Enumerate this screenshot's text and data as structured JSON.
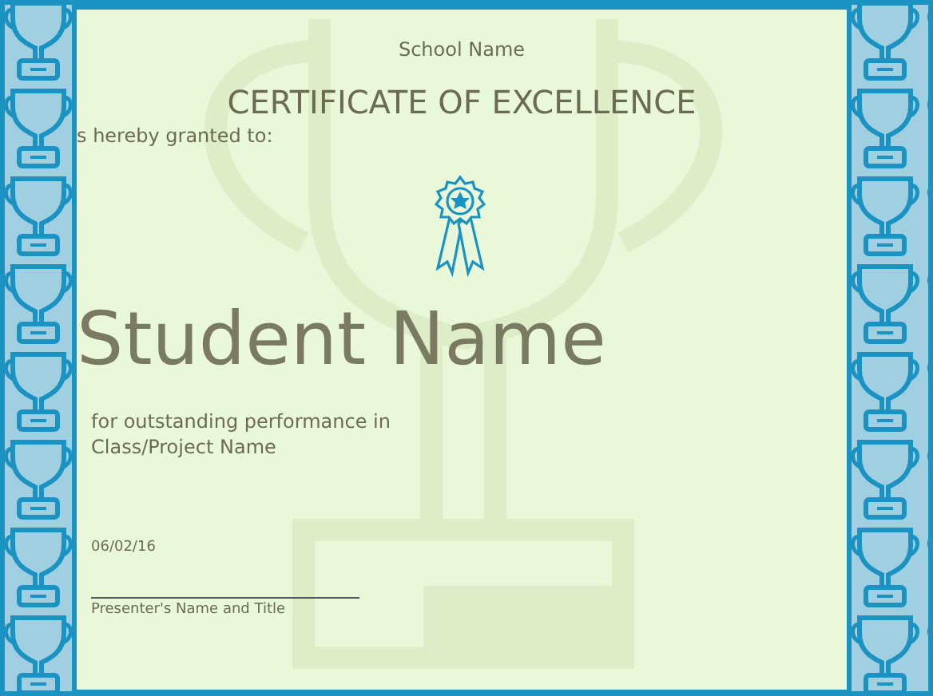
{
  "certificate": {
    "school": "School Name",
    "title": "CERTIFICATE OF EXCELLENCE",
    "granted_text": "s hereby granted to:",
    "recipient": "Student Name",
    "reason_lines": [
      "for outstanding performance in",
      "Class/Project Name"
    ],
    "date": "06/02/16",
    "signature_label": "Presenter's Name and Title"
  }
}
